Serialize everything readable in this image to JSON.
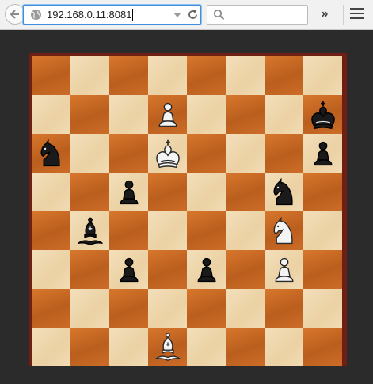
{
  "browser": {
    "url": "192.168.0.11:8081",
    "search_placeholder": "",
    "overflow_label": "»"
  },
  "board": {
    "orientation": "white-bottom",
    "pieces": [
      {
        "square": "d7",
        "color": "white",
        "type": "pawn"
      },
      {
        "square": "h7",
        "color": "black",
        "type": "king"
      },
      {
        "square": "a6",
        "color": "black",
        "type": "knight"
      },
      {
        "square": "d6",
        "color": "white",
        "type": "king"
      },
      {
        "square": "h6",
        "color": "black",
        "type": "pawn"
      },
      {
        "square": "c5",
        "color": "black",
        "type": "pawn"
      },
      {
        "square": "g5",
        "color": "black",
        "type": "knight"
      },
      {
        "square": "b4",
        "color": "black",
        "type": "bishop"
      },
      {
        "square": "g4",
        "color": "white",
        "type": "knight"
      },
      {
        "square": "c3",
        "color": "black",
        "type": "pawn"
      },
      {
        "square": "e3",
        "color": "black",
        "type": "pawn"
      },
      {
        "square": "g3",
        "color": "white",
        "type": "pawn"
      },
      {
        "square": "d1",
        "color": "white",
        "type": "bishop"
      }
    ]
  }
}
